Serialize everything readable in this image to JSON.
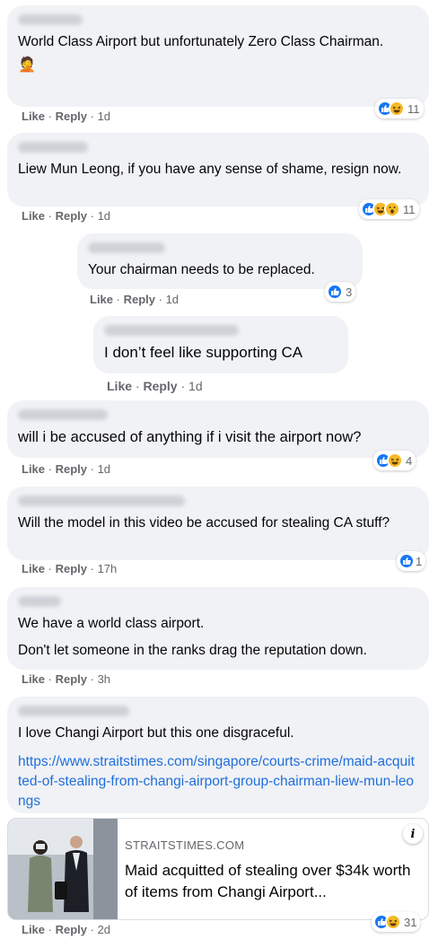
{
  "action_labels": {
    "like": "Like",
    "reply": "Reply",
    "separator": "·"
  },
  "comments": [
    {
      "text": "World Class Airport but unfortunately Zero Class Chairman.",
      "emoji": "🤦",
      "time": "1d",
      "reaction_count": "11",
      "reactions": [
        "like",
        "haha"
      ]
    },
    {
      "text": "Liew Mun Leong, if you have any sense of shame, resign now.",
      "time": "1d",
      "reaction_count": "11",
      "reactions": [
        "like",
        "haha",
        "wow"
      ]
    },
    {
      "text": "Your chairman needs to be replaced.",
      "time": "1d",
      "reaction_count": "3",
      "reactions": [
        "like"
      ]
    },
    {
      "text": "I don’t feel like supporting CA",
      "time": "1d"
    },
    {
      "text": "will i be accused of anything if i visit the airport now?",
      "time": "1d",
      "reaction_count": "4",
      "reactions": [
        "like",
        "haha"
      ]
    },
    {
      "text": "Will the model in this video be accused for stealing CA stuff?",
      "time": "17h",
      "reaction_count": "1",
      "reactions": [
        "like"
      ]
    },
    {
      "lines": [
        "We have a world class airport.",
        "Don't let someone in the ranks drag the reputation down."
      ],
      "time": "3h"
    },
    {
      "text": "I love Changi Airport but this one disgraceful.",
      "link": "https://www.straitstimes.com/singapore/courts-crime/maid-acquitted-of-stealing-from-changi-airport-group-chairman-liew-mun-leongs",
      "time": "2d",
      "reaction_count": "31",
      "reactions": [
        "like",
        "haha"
      ]
    }
  ],
  "link_preview": {
    "domain": "STRAITSTIMES.COM",
    "title": "Maid acquitted of stealing over $34k worth of items from Changi Airport..."
  },
  "colors": {
    "like": "#1877f2",
    "haha": "#f7b928",
    "bubble": "#f0f2f5",
    "link": "#216fdb",
    "meta": "#65676b"
  },
  "icons": {
    "like": "thumbs-up-icon",
    "haha": "laughing-face-icon",
    "wow": "surprised-face-icon",
    "info": "info-icon"
  }
}
